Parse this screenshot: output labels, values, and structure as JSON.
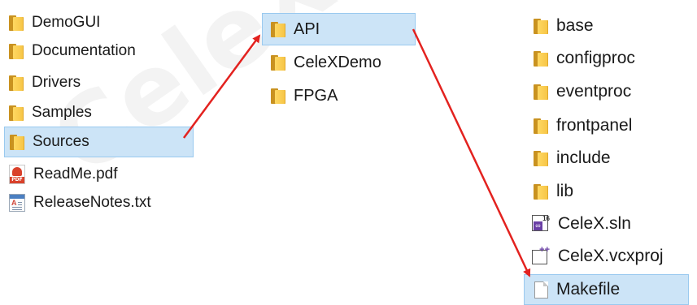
{
  "column1": {
    "items": [
      {
        "label": "DemoGUI",
        "icon": "folder-icon",
        "selected": false
      },
      {
        "label": "Documentation",
        "icon": "folder-icon",
        "selected": false
      },
      {
        "label": "Drivers",
        "icon": "folder-icon",
        "selected": false
      },
      {
        "label": "Samples",
        "icon": "folder-icon",
        "selected": false
      },
      {
        "label": "Sources",
        "icon": "folder-icon",
        "selected": true
      },
      {
        "label": "ReadMe.pdf",
        "icon": "pdf-file-icon",
        "selected": false
      },
      {
        "label": "ReleaseNotes.txt",
        "icon": "text-file-icon",
        "selected": false
      }
    ]
  },
  "column2": {
    "items": [
      {
        "label": "API",
        "icon": "folder-icon",
        "selected": true
      },
      {
        "label": "CeleXDemo",
        "icon": "folder-icon",
        "selected": false
      },
      {
        "label": "FPGA",
        "icon": "folder-icon",
        "selected": false
      }
    ]
  },
  "column3": {
    "items": [
      {
        "label": "base",
        "icon": "folder-icon",
        "selected": false
      },
      {
        "label": "configproc",
        "icon": "folder-icon",
        "selected": false
      },
      {
        "label": "eventproc",
        "icon": "folder-icon",
        "selected": false
      },
      {
        "label": "frontpanel",
        "icon": "folder-icon",
        "selected": false
      },
      {
        "label": "include",
        "icon": "folder-icon",
        "selected": false
      },
      {
        "label": "lib",
        "icon": "folder-icon",
        "selected": false
      },
      {
        "label": "CeleX.sln",
        "icon": "visual-studio-solution-icon",
        "selected": false
      },
      {
        "label": "CeleX.vcxproj",
        "icon": "visual-studio-project-icon",
        "selected": false
      },
      {
        "label": "Makefile",
        "icon": "file-icon",
        "selected": true
      }
    ]
  },
  "colors": {
    "selection_background": "#cce4f7",
    "selection_border": "#99c9ef",
    "arrow": "#e3221f",
    "folder": "#f6c445"
  }
}
